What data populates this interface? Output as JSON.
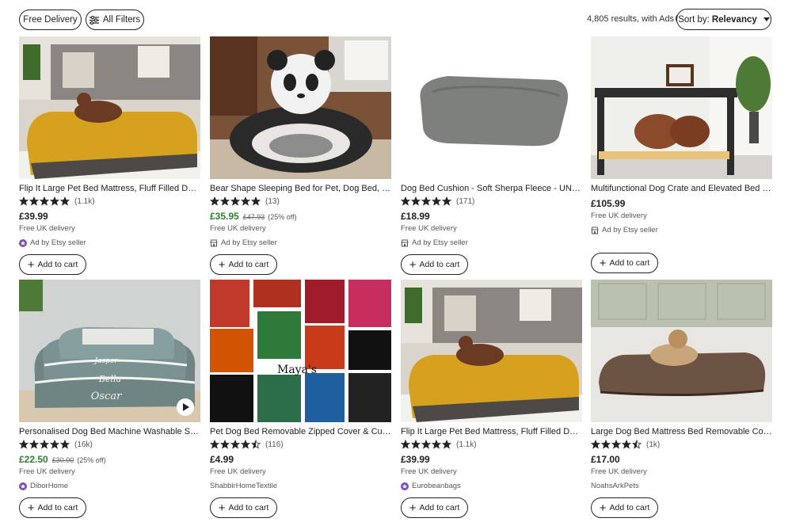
{
  "filters": {
    "free_delivery": "Free Delivery",
    "all_filters": "All Filters"
  },
  "results": {
    "text": "4,805 results, with Ads",
    "help_icon": "?"
  },
  "sort": {
    "label": "Sort by:",
    "value": "Relevancy"
  },
  "products": [
    {
      "title": "Flip It Large Pet Bed Mattress, Fluff Filled Dog B...",
      "stars": 5,
      "count": "(1.1k)",
      "price": "£39.99",
      "sale": false,
      "original": "",
      "discount": "",
      "delivery": "Free UK delivery",
      "seller": "Ad by Etsy seller",
      "seller_icon": "star-badge-icon",
      "cart": "Add to cart"
    },
    {
      "title": "Bear Shape Sleeping Bed for Pet, Dog Bed, Cat...",
      "stars": 5,
      "count": "(13)",
      "price": "£35.95",
      "sale": true,
      "original": "£47.93",
      "discount": "(25% off)",
      "delivery": "Free UK delivery",
      "seller": "Ad by Etsy seller",
      "seller_icon": "shop-icon",
      "cart": "Add to cart"
    },
    {
      "title": "Dog Bed Cushion - Soft Sherpa Fleece - UNIQU...",
      "stars": 5,
      "count": "(171)",
      "price": "£18.99",
      "sale": false,
      "original": "",
      "discount": "",
      "delivery": "Free UK delivery",
      "seller": "Ad by Etsy seller",
      "seller_icon": "shop-icon",
      "cart": "Add to cart"
    },
    {
      "title": "Multifunctional Dog Crate and Elevated Bed wi...",
      "stars": 0,
      "count": "",
      "price": "£105.99",
      "sale": false,
      "original": "",
      "discount": "",
      "delivery": "Free UK delivery",
      "seller": "Ad by Etsy seller",
      "seller_icon": "shop-icon",
      "cart": "Add to cart"
    },
    {
      "title": "Personalised Dog Bed Machine Washable Supe...",
      "stars": 5,
      "count": "(16k)",
      "price": "£22.50",
      "sale": true,
      "original": "£30.00",
      "discount": "(25% off)",
      "delivery": "Free UK delivery",
      "seller": "DiborHome",
      "seller_icon": "star-badge-icon",
      "cart": "Add to cart",
      "video": true
    },
    {
      "title": "Pet Dog Bed Removable Zipped Cover & Cushi...",
      "stars": 4.5,
      "count": "(116)",
      "price": "£4.99",
      "sale": false,
      "original": "",
      "discount": "",
      "delivery": "Free UK delivery",
      "seller": "ShabbirHomeTextile",
      "seller_icon": "",
      "cart": "Add to cart"
    },
    {
      "title": "Flip It Large Pet Bed Mattress, Fluff Filled Dog B...",
      "stars": 5,
      "count": "(1.1k)",
      "price": "£39.99",
      "sale": false,
      "original": "",
      "discount": "",
      "delivery": "Free UK delivery",
      "seller": "Eurobeanbags",
      "seller_icon": "star-badge-icon",
      "cart": "Add to cart"
    },
    {
      "title": "Large Dog Bed Mattress Bed Removable Cover ...",
      "stars": 4.5,
      "count": "(1k)",
      "price": "£17.00",
      "sale": false,
      "original": "",
      "discount": "",
      "delivery": "Free UK delivery",
      "seller": "NoahsArkPets",
      "seller_icon": "",
      "cart": "Add to cart"
    }
  ],
  "colors": {
    "sale_price": "#2e7d32",
    "star_badge": "#7b4fb8",
    "ink": "#222222"
  }
}
